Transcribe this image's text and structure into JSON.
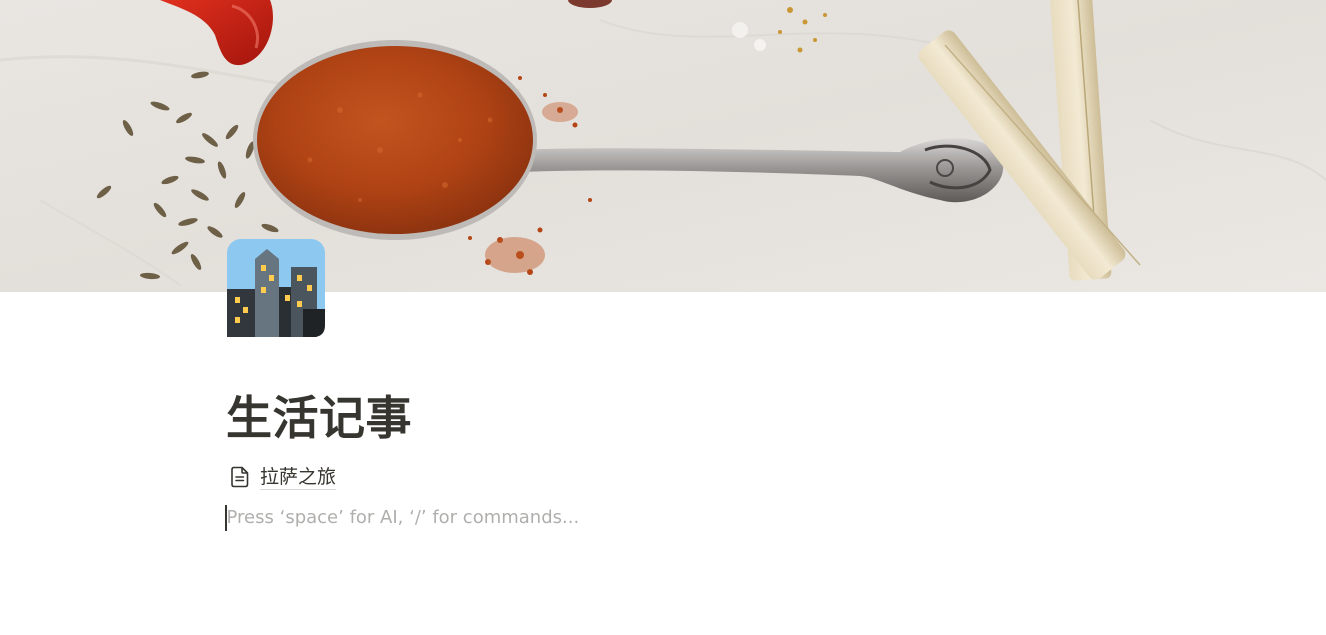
{
  "cover": {
    "description_icon": "spice-spoon-cover-image"
  },
  "page": {
    "icon": "night-city-emoji-icon",
    "title": "生活记事"
  },
  "subpages": [
    {
      "icon": "document-icon",
      "label": "拉萨之旅"
    }
  ],
  "editor": {
    "placeholder": "Press ‘space’ for AI, ‘/’ for commands..."
  }
}
